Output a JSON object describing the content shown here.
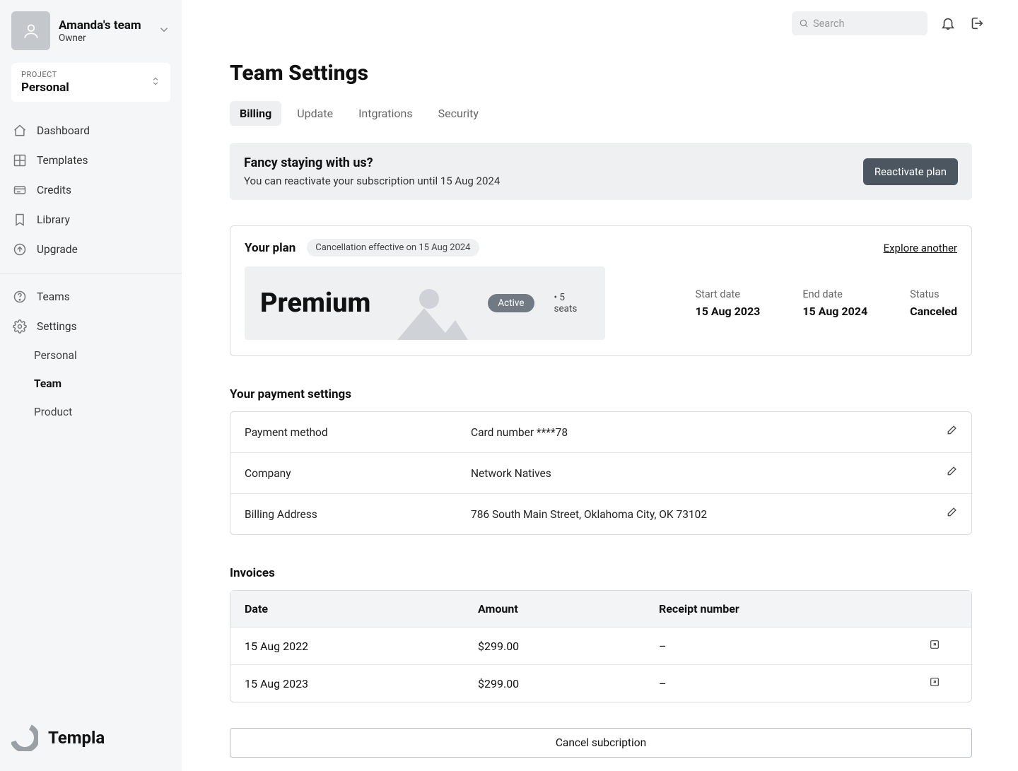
{
  "sidebar": {
    "team_name": "Amanda's team",
    "team_role": "Owner",
    "project_label": "PROJECT",
    "project_name": "Personal",
    "nav": [
      {
        "label": "Dashboard",
        "icon": "home"
      },
      {
        "label": "Templates",
        "icon": "grid"
      },
      {
        "label": "Credits",
        "icon": "credits"
      },
      {
        "label": "Library",
        "icon": "bookmark"
      },
      {
        "label": "Upgrade",
        "icon": "upgrade"
      }
    ],
    "nav2": [
      {
        "label": "Teams",
        "icon": "help"
      },
      {
        "label": "Settings",
        "icon": "gear"
      }
    ],
    "sub_nav": [
      {
        "label": "Personal"
      },
      {
        "label": "Team"
      },
      {
        "label": "Product"
      }
    ],
    "brand": "Templa"
  },
  "topbar": {
    "search_placeholder": "Search"
  },
  "page": {
    "title": "Team Settings",
    "tabs": [
      "Billing",
      "Update",
      "Intgrations",
      "Security"
    ],
    "banner": {
      "title": "Fancy staying with us?",
      "subtitle": "You can reactivate your subscription until 15 Aug 2024",
      "button": "Reactivate plan"
    },
    "plan": {
      "label": "Your plan",
      "chip": "Cancellation effective on 15 Aug 2024",
      "explore": "Explore another",
      "name": "Premium",
      "status_badge": "Active",
      "seats": "• 5 seats",
      "start_label": "Start date",
      "start_value": "15 Aug 2023",
      "end_label": "End date",
      "end_value": "15 Aug 2024",
      "status_label": "Status",
      "status_value": "Canceled"
    },
    "payment": {
      "title": "Your payment settings",
      "rows": [
        {
          "key": "Payment method",
          "value": "Card number ****78"
        },
        {
          "key": "Company",
          "value": "Network Natives"
        },
        {
          "key": "Billing Address",
          "value": "786 South Main Street, Oklahoma City, OK 73102"
        }
      ]
    },
    "invoices": {
      "title": "Invoices",
      "headers": {
        "date": "Date",
        "amount": "Amount",
        "receipt": "Receipt number"
      },
      "rows": [
        {
          "date": "15 Aug 2022",
          "amount": "$299.00",
          "receipt": "–"
        },
        {
          "date": "15 Aug 2023",
          "amount": "$299.00",
          "receipt": "–"
        }
      ]
    },
    "cancel_button": "Cancel subcription"
  }
}
